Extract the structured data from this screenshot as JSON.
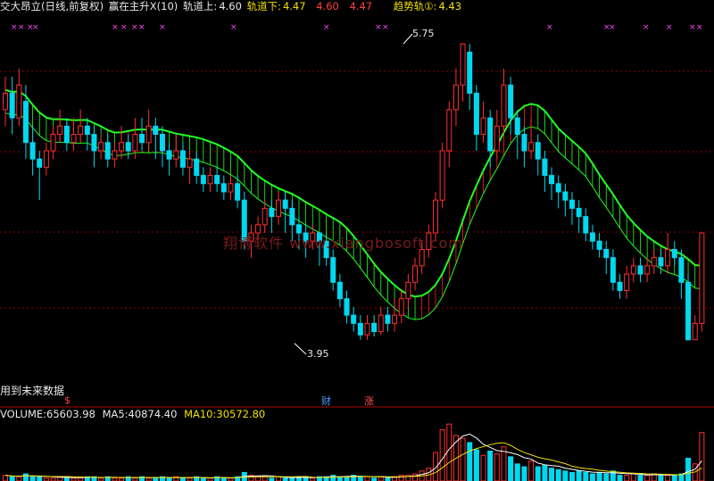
{
  "header": {
    "stock_name": "交大昂立(日线,前复权)",
    "indicator": "赢在主升X(10)",
    "upper_label": "轨道上:",
    "upper_value": "4.60",
    "lower_label": "轨道下:",
    "lower_value": "4.47",
    "v1": "4.60",
    "v2": "4.47",
    "trend_label": "趋势轨①:",
    "trend_value": "4.43"
  },
  "annotations": {
    "high": "5.75",
    "low": "3.95",
    "future_data": "用到未来数据",
    "dollar": "$",
    "cai": "财",
    "zhang": "涨",
    "watermark": "翔博软件 www.xiangbosoft.com"
  },
  "volume_header": {
    "vol_label": "VOLUME:",
    "vol_value": "65603.98",
    "ma5_label": "MA5:",
    "ma5_value": "40874.40",
    "ma10_label": "MA10:",
    "ma10_value": "30572.80"
  },
  "colors": {
    "up": "#ff3030",
    "down": "#00d8f0",
    "band": "#22ff22",
    "band_low": "#ff2020",
    "ma5": "#ffffff",
    "ma10": "#f0e000",
    "grid": "#8b0000",
    "marker": "#ff40ff"
  },
  "chart_data": {
    "type": "candlestick",
    "price_high": 5.75,
    "price_low": 3.95,
    "candles": [
      [
        5.35,
        5.45,
        5.55,
        5.25
      ],
      [
        5.45,
        5.3,
        5.55,
        5.2
      ],
      [
        5.3,
        5.5,
        5.6,
        5.25
      ],
      [
        5.4,
        5.15,
        5.5,
        5.05
      ],
      [
        5.15,
        5.05,
        5.25,
        4.95
      ],
      [
        5.05,
        5.0,
        5.1,
        4.8
      ],
      [
        5.0,
        5.1,
        5.15,
        4.95
      ],
      [
        5.1,
        5.2,
        5.25,
        5.05
      ],
      [
        5.2,
        5.25,
        5.35,
        5.15
      ],
      [
        5.25,
        5.15,
        5.3,
        5.1
      ],
      [
        5.15,
        5.2,
        5.3,
        5.1
      ],
      [
        5.2,
        5.25,
        5.35,
        5.15
      ],
      [
        5.25,
        5.2,
        5.3,
        5.1
      ],
      [
        5.2,
        5.1,
        5.25,
        5.0
      ],
      [
        5.1,
        5.15,
        5.2,
        5.05
      ],
      [
        5.15,
        5.05,
        5.2,
        5.0
      ],
      [
        5.05,
        5.1,
        5.15,
        5.0
      ],
      [
        5.1,
        5.15,
        5.25,
        5.05
      ],
      [
        5.15,
        5.1,
        5.2,
        5.05
      ],
      [
        5.1,
        5.2,
        5.3,
        5.05
      ],
      [
        5.2,
        5.15,
        5.3,
        5.1
      ],
      [
        5.15,
        5.25,
        5.35,
        5.1
      ],
      [
        5.25,
        5.2,
        5.3,
        5.05
      ],
      [
        5.2,
        5.1,
        5.25,
        5.0
      ],
      [
        5.1,
        5.05,
        5.15,
        4.95
      ],
      [
        5.05,
        5.1,
        5.2,
        5.0
      ],
      [
        5.1,
        5.0,
        5.15,
        4.95
      ],
      [
        5.0,
        5.05,
        5.1,
        4.9
      ],
      [
        5.05,
        4.95,
        5.1,
        4.9
      ],
      [
        4.95,
        4.9,
        5.0,
        4.85
      ],
      [
        4.9,
        4.95,
        5.0,
        4.85
      ],
      [
        4.95,
        4.9,
        5.0,
        4.85
      ],
      [
        4.9,
        4.85,
        4.95,
        4.8
      ],
      [
        4.85,
        4.9,
        4.95,
        4.8
      ],
      [
        4.9,
        4.8,
        4.95,
        4.75
      ],
      [
        4.8,
        4.55,
        4.85,
        4.5
      ],
      [
        4.55,
        4.6,
        4.65,
        4.45
      ],
      [
        4.6,
        4.65,
        4.7,
        4.55
      ],
      [
        4.65,
        4.75,
        4.8,
        4.6
      ],
      [
        4.75,
        4.7,
        4.8,
        4.6
      ],
      [
        4.7,
        4.8,
        4.85,
        4.65
      ],
      [
        4.8,
        4.75,
        4.85,
        4.6
      ],
      [
        4.75,
        4.65,
        4.8,
        4.55
      ],
      [
        4.65,
        4.6,
        4.7,
        4.5
      ],
      [
        4.6,
        4.55,
        4.65,
        4.45
      ],
      [
        4.55,
        4.6,
        4.65,
        4.5
      ],
      [
        4.6,
        4.55,
        4.6,
        4.4
      ],
      [
        4.55,
        4.45,
        4.6,
        4.4
      ],
      [
        4.45,
        4.3,
        4.5,
        4.25
      ],
      [
        4.3,
        4.2,
        4.35,
        4.15
      ],
      [
        4.2,
        4.1,
        4.25,
        4.05
      ],
      [
        4.1,
        4.05,
        4.15,
        4.0
      ],
      [
        4.05,
        3.98,
        4.1,
        3.95
      ],
      [
        3.98,
        4.05,
        4.1,
        3.95
      ],
      [
        4.05,
        4.0,
        4.1,
        3.97
      ],
      [
        4.0,
        4.1,
        4.15,
        3.98
      ],
      [
        4.1,
        4.05,
        4.15,
        4.0
      ],
      [
        4.05,
        4.1,
        4.2,
        4.0
      ],
      [
        4.1,
        4.2,
        4.25,
        4.05
      ],
      [
        4.2,
        4.3,
        4.35,
        4.15
      ],
      [
        4.3,
        4.4,
        4.45,
        4.25
      ],
      [
        4.4,
        4.5,
        4.55,
        4.35
      ],
      [
        4.5,
        4.6,
        4.65,
        4.45
      ],
      [
        4.6,
        4.8,
        4.85,
        4.55
      ],
      [
        4.8,
        5.1,
        5.15,
        4.75
      ],
      [
        5.1,
        5.35,
        5.4,
        5.0
      ],
      [
        5.35,
        5.5,
        5.6,
        5.25
      ],
      [
        5.5,
        5.75,
        5.75,
        5.4
      ],
      [
        5.7,
        5.45,
        5.75,
        5.35
      ],
      [
        5.45,
        5.2,
        5.5,
        5.1
      ],
      [
        5.2,
        5.3,
        5.4,
        5.15
      ],
      [
        5.3,
        5.1,
        5.35,
        5.0
      ],
      [
        5.1,
        5.25,
        5.35,
        5.05
      ],
      [
        5.25,
        5.5,
        5.6,
        5.2
      ],
      [
        5.5,
        5.3,
        5.55,
        5.2
      ],
      [
        5.3,
        5.2,
        5.35,
        5.05
      ],
      [
        5.2,
        5.1,
        5.25,
        5.0
      ],
      [
        5.1,
        5.15,
        5.3,
        5.05
      ],
      [
        5.15,
        5.05,
        5.2,
        4.95
      ],
      [
        5.05,
        4.95,
        5.1,
        4.85
      ],
      [
        4.95,
        4.9,
        5.0,
        4.8
      ],
      [
        4.9,
        4.85,
        4.95,
        4.75
      ],
      [
        4.85,
        4.8,
        4.9,
        4.7
      ],
      [
        4.8,
        4.75,
        4.85,
        4.65
      ],
      [
        4.75,
        4.7,
        4.8,
        4.6
      ],
      [
        4.7,
        4.6,
        4.75,
        4.55
      ],
      [
        4.6,
        4.55,
        4.65,
        4.5
      ],
      [
        4.55,
        4.5,
        4.6,
        4.45
      ],
      [
        4.5,
        4.45,
        4.55,
        4.35
      ],
      [
        4.45,
        4.3,
        4.5,
        4.25
      ],
      [
        4.3,
        4.25,
        4.35,
        4.2
      ],
      [
        4.25,
        4.35,
        4.4,
        4.2
      ],
      [
        4.35,
        4.4,
        4.45,
        4.3
      ],
      [
        4.4,
        4.35,
        4.45,
        4.3
      ],
      [
        4.35,
        4.4,
        4.45,
        4.3
      ],
      [
        4.4,
        4.45,
        4.5,
        4.35
      ],
      [
        4.45,
        4.4,
        4.5,
        4.35
      ],
      [
        4.4,
        4.5,
        4.6,
        4.35
      ],
      [
        4.5,
        4.45,
        4.55,
        4.4
      ],
      [
        4.45,
        4.3,
        4.5,
        4.2
      ],
      [
        4.3,
        3.95,
        4.35,
        3.95
      ],
      [
        3.95,
        4.05,
        4.1,
        3.95
      ],
      [
        4.05,
        4.6,
        4.6,
        4.0
      ]
    ],
    "volume": [
      4,
      3,
      3,
      5,
      3,
      3,
      2,
      2,
      3,
      3,
      2,
      2,
      3,
      3,
      2,
      3,
      2,
      2,
      3,
      2,
      3,
      2,
      2,
      3,
      2,
      3,
      2,
      2,
      3,
      2,
      2,
      3,
      2,
      2,
      3,
      6,
      4,
      3,
      3,
      2,
      3,
      2,
      2,
      3,
      3,
      2,
      3,
      3,
      4,
      3,
      3,
      4,
      3,
      3,
      2,
      3,
      2,
      3,
      4,
      4,
      5,
      7,
      9,
      20,
      36,
      40,
      32,
      30,
      27,
      22,
      18,
      21,
      19,
      24,
      17,
      12,
      10,
      14,
      10,
      11,
      9,
      8,
      7,
      6,
      7,
      6,
      5,
      6,
      5,
      7,
      4,
      4,
      5,
      4,
      4,
      5,
      4,
      4,
      4,
      5,
      16,
      12,
      34
    ]
  }
}
